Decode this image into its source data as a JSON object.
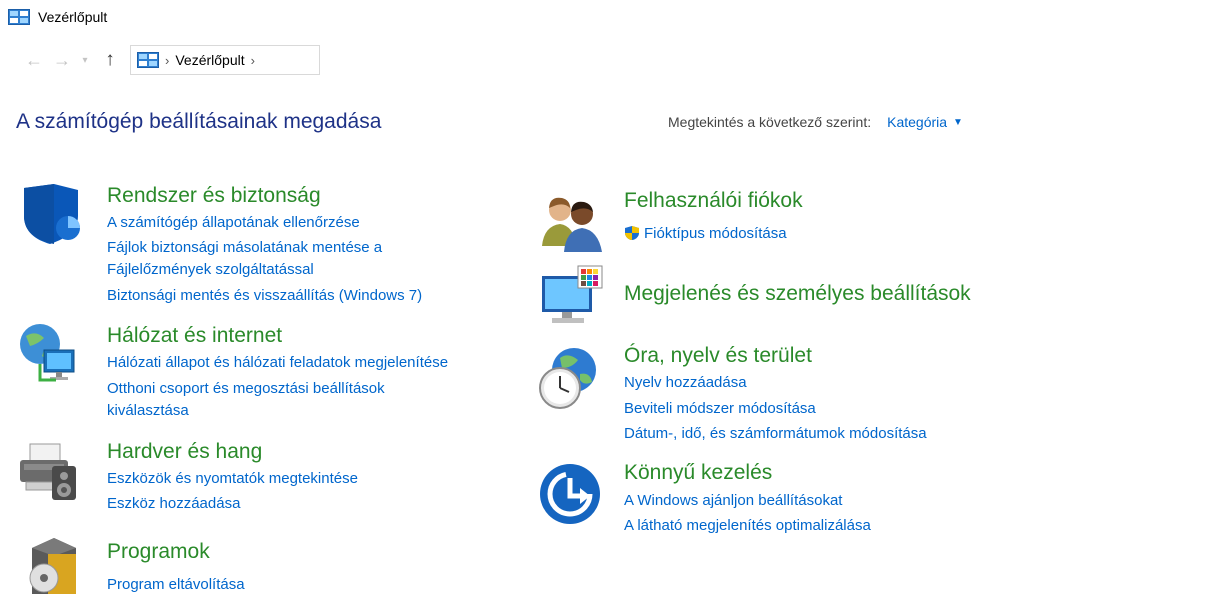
{
  "window": {
    "title": "Vezérlőpult"
  },
  "nav": {
    "breadcrumb": "Vezérlőpult"
  },
  "header": {
    "title": "A számítógép beállításainak megadása",
    "viewby_label": "Megtekintés a következő szerint:",
    "viewby_value": "Kategória"
  },
  "left": {
    "system": {
      "title": "Rendszer és biztonság",
      "link1": "A számítógép állapotának ellenőrzése",
      "link2a": "Fájlok biztonsági másolatának mentése a",
      "link2b": "Fájlelőzmények szolgáltatással",
      "link3": "Biztonsági mentés és visszaállítás (Windows 7)"
    },
    "network": {
      "title": "Hálózat és internet",
      "link1": "Hálózati állapot és hálózati feladatok megjelenítése",
      "link2a": "Otthoni csoport és megosztási beállítások",
      "link2b": "kiválasztása"
    },
    "hardware": {
      "title": "Hardver és hang",
      "link1": "Eszközök és nyomtatók megtekintése",
      "link2": "Eszköz hozzáadása"
    },
    "programs": {
      "title": "Programok",
      "link1": "Program eltávolítása"
    }
  },
  "right": {
    "accounts": {
      "title": "Felhasználói fiókok",
      "link1": "Fióktípus módosítása"
    },
    "appearance": {
      "title": "Megjelenés és személyes beállítások"
    },
    "clock": {
      "title": "Óra, nyelv és terület",
      "link1": "Nyelv hozzáadása",
      "link2": "Beviteli módszer módosítása",
      "link3": "Dátum-, idő, és számformátumok módosítása"
    },
    "ease": {
      "title": "Könnyű kezelés",
      "link1": "A Windows ajánljon beállításokat",
      "link2": "A látható megjelenítés optimalizálása"
    }
  }
}
